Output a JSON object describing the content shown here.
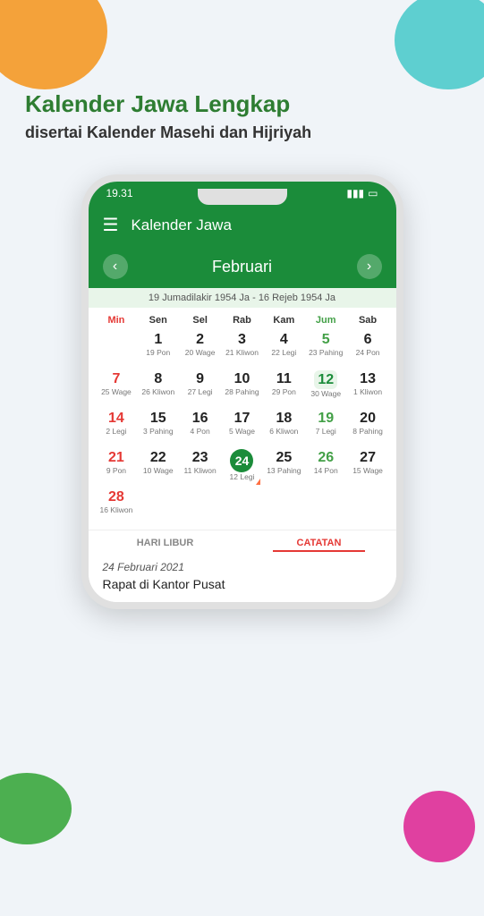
{
  "blobs": {
    "orange": "orange-blob",
    "teal": "teal-blob",
    "green": "green-blob",
    "pink": "pink-blob"
  },
  "header": {
    "line1_normal": "Kalender ",
    "line1_bold": "Jawa Lengkap",
    "line2_normal": "disertai Kalender ",
    "line2_bold1": "Masehi",
    "line2_normal2": " dan ",
    "line2_bold2": "Hijriyah"
  },
  "statusBar": {
    "time": "19.31",
    "signal": "▮▮▮",
    "battery": "🔋"
  },
  "appBar": {
    "title": "Kalender Jawa",
    "hamburger": "☰"
  },
  "calendar": {
    "prevBtn": "‹",
    "nextBtn": "›",
    "month": "Februari",
    "hijriRange": "19 Jumadilakir 1954 Ja - 16 Rejeb 1954 Ja",
    "dayHeaders": [
      "Min",
      "Sen",
      "Sel",
      "Rab",
      "Kam",
      "Jum",
      "Sab"
    ],
    "weeks": [
      [
        {
          "day": "",
          "jawa": "",
          "type": "empty"
        },
        {
          "day": "1",
          "jawa": "19 Pon",
          "type": "normal"
        },
        {
          "day": "2",
          "jawa": "20 Wage",
          "type": "normal"
        },
        {
          "day": "3",
          "jawa": "21 Kliwon",
          "type": "normal"
        },
        {
          "day": "4",
          "jawa": "22 Legi",
          "type": "normal"
        },
        {
          "day": "5",
          "jawa": "23 Pahing",
          "type": "friday"
        },
        {
          "day": "6",
          "jawa": "24 Pon",
          "type": "normal"
        }
      ],
      [
        {
          "day": "7",
          "jawa": "25 Wage",
          "type": "sunday"
        },
        {
          "day": "8",
          "jawa": "26 Kliwon",
          "type": "normal"
        },
        {
          "day": "9",
          "jawa": "27 Legi",
          "type": "normal"
        },
        {
          "day": "10",
          "jawa": "28 Pahing",
          "type": "normal"
        },
        {
          "day": "11",
          "jawa": "29 Pon",
          "type": "normal"
        },
        {
          "day": "12",
          "jawa": "30 Wage",
          "type": "today"
        },
        {
          "day": "13",
          "jawa": "1 Kliwon",
          "type": "normal"
        }
      ],
      [
        {
          "day": "14",
          "jawa": "2 Legi",
          "type": "sunday"
        },
        {
          "day": "15",
          "jawa": "3 Pahing",
          "type": "normal"
        },
        {
          "day": "16",
          "jawa": "4 Pon",
          "type": "normal"
        },
        {
          "day": "17",
          "jawa": "5 Wage",
          "type": "normal"
        },
        {
          "day": "18",
          "jawa": "6 Kliwon",
          "type": "normal"
        },
        {
          "day": "19",
          "jawa": "7 Legi",
          "type": "friday"
        },
        {
          "day": "20",
          "jawa": "8 Pahing",
          "type": "normal"
        }
      ],
      [
        {
          "day": "21",
          "jawa": "9 Pon",
          "type": "sunday"
        },
        {
          "day": "22",
          "jawa": "10 Wage",
          "type": "normal"
        },
        {
          "day": "23",
          "jawa": "11 Kliwon",
          "type": "normal"
        },
        {
          "day": "24",
          "jawa": "12 Legi",
          "type": "selected",
          "hasTriangle": true
        },
        {
          "day": "25",
          "jawa": "13 Pahing",
          "type": "normal"
        },
        {
          "day": "26",
          "jawa": "14 Pon",
          "type": "friday"
        },
        {
          "day": "27",
          "jawa": "15 Wage",
          "type": "normal"
        }
      ],
      [
        {
          "day": "28",
          "jawa": "16 Kliwon",
          "type": "sunday"
        },
        {
          "day": "",
          "jawa": "",
          "type": "empty"
        },
        {
          "day": "",
          "jawa": "",
          "type": "empty"
        },
        {
          "day": "",
          "jawa": "",
          "type": "empty"
        },
        {
          "day": "",
          "jawa": "",
          "type": "empty"
        },
        {
          "day": "",
          "jawa": "",
          "type": "empty"
        },
        {
          "day": "",
          "jawa": "",
          "type": "empty"
        }
      ]
    ]
  },
  "tabs": [
    {
      "label": "HARI LIBUR",
      "active": false
    },
    {
      "label": "CATATAN",
      "active": true
    }
  ],
  "note": {
    "date": "24 Februari 2021",
    "text": "Rapat di Kantor Pusat"
  }
}
